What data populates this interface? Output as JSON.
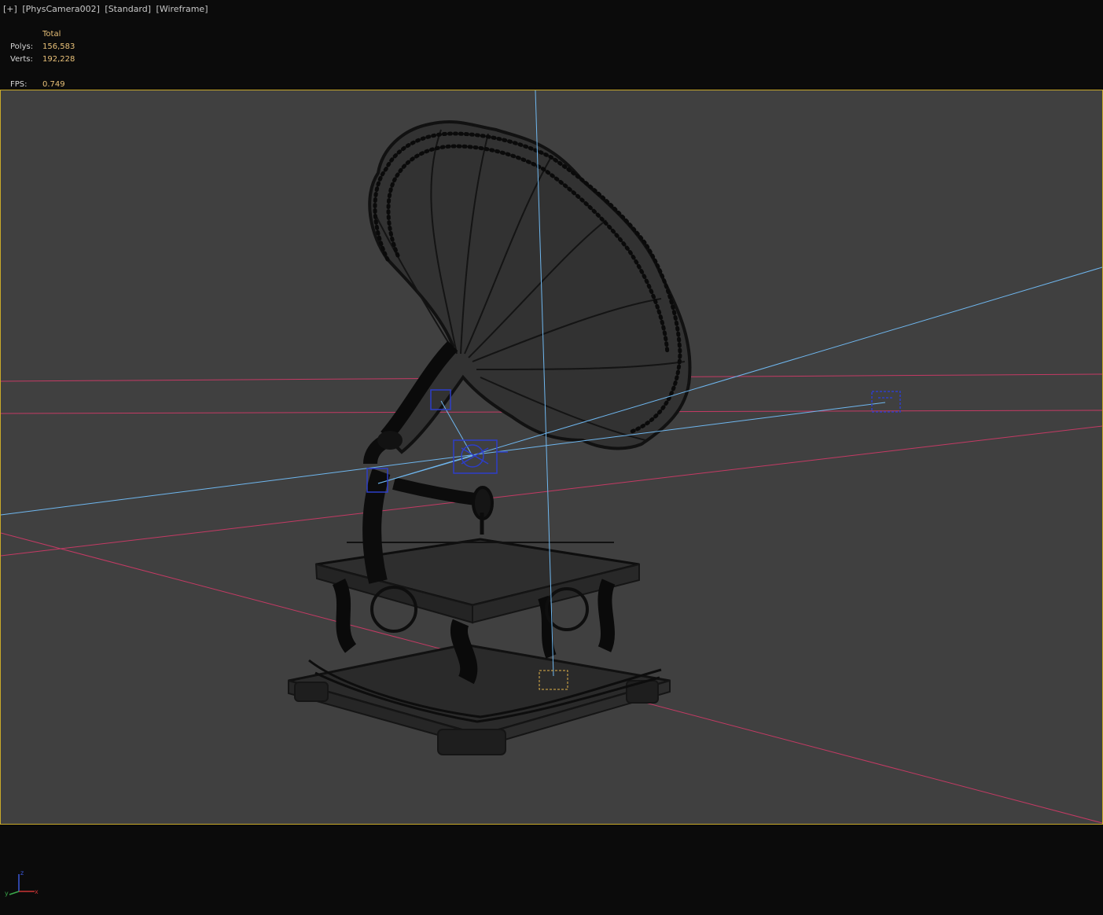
{
  "viewport": {
    "menu_label": "[+]",
    "camera_label": "[PhysCamera002]",
    "shading_label": "[Standard]",
    "mode_label": "[Wireframe]"
  },
  "stats": {
    "header": "Total",
    "polys_label": "Polys:",
    "polys_value": "156,583",
    "verts_label": "Verts:",
    "verts_value": "192,228",
    "fps_label": "FPS:",
    "fps_value": "0.749"
  },
  "axes": {
    "x_label": "x",
    "y_label": "y",
    "z_label": "z"
  },
  "colors": {
    "background": "#0b0b0b",
    "viewport_bg": "#404040",
    "safe_frame_border": "#c9a92a",
    "stat_value": "#e8c078",
    "grid_line": "#c43a64",
    "camera_line": "#6fb7ef",
    "helper_blue": "#2d3ec8"
  }
}
